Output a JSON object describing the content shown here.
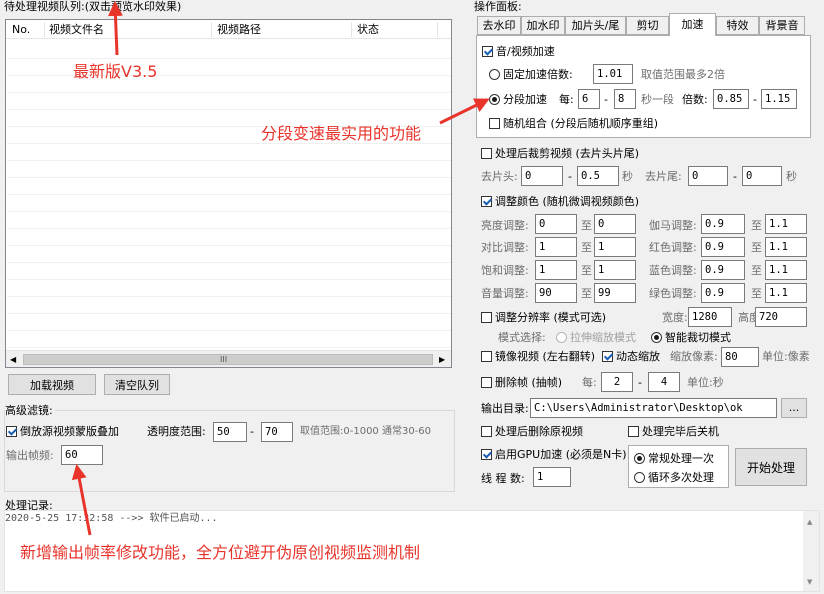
{
  "queue": {
    "title": "待处理视频队列:",
    "title_overlay": "(双击预览水印效果)",
    "columns": [
      "No.",
      "视频文件名",
      "视频路径",
      "状态"
    ],
    "scroll_mark": "III",
    "load_button": "加载视频",
    "clear_button": "清空队列"
  },
  "advanced": {
    "title": "高级滤镜:",
    "overlay_checkbox": "倒放源视频蒙版叠加",
    "transparency_label": "透明度范围:",
    "transparency_min": "50",
    "transparency_max": "70",
    "transparency_hint": "取值范围:0-1000 通常30-60",
    "fps_label": "输出帧频:",
    "fps_value": "60"
  },
  "log": {
    "title": "处理记录:",
    "entry": "2020-5-25 17:32:58 -->> 软件已启动..."
  },
  "panel": {
    "title": "操作面板:",
    "tabs": [
      "去水印",
      "加水印",
      "加片头/尾",
      "剪切",
      "加速",
      "特效",
      "背景音"
    ],
    "speed": {
      "checkbox": "音/视频加速",
      "fixed_label": "固定加速倍数:",
      "fixed_value": "1.01",
      "fixed_hint": "取值范围最多2倍",
      "segment_label": "分段加速",
      "every_label": "每:",
      "seg_min": "6",
      "seg_max": "8",
      "seg_unit": "秒一段",
      "rate_label": "倍数:",
      "rate_min": "0.85",
      "rate_max": "1.15",
      "random_checkbox": "随机组合 (分段后随机顺序重组)"
    },
    "trim": {
      "checkbox": "处理后裁剪视频 (去片头片尾)",
      "head_label": "去片头:",
      "head_min": "0",
      "head_max": "0.5",
      "sec": "秒",
      "tail_label": "去片尾:",
      "tail_min": "0",
      "tail_max": "0"
    },
    "color": {
      "checkbox": "调整颜色 (随机微调视频颜色)",
      "to": "至",
      "rows": [
        {
          "l1": "亮度调整:",
          "a1": "0",
          "b1": "0",
          "l2": "伽马调整:",
          "a2": "0.9",
          "b2": "1.1"
        },
        {
          "l1": "对比调整:",
          "a1": "1",
          "b1": "1",
          "l2": "红色调整:",
          "a2": "0.9",
          "b2": "1.1"
        },
        {
          "l1": "饱和调整:",
          "a1": "1",
          "b1": "1",
          "l2": "蓝色调整:",
          "a2": "0.9",
          "b2": "1.1"
        },
        {
          "l1": "音量调整:",
          "a1": "90",
          "b1": "99",
          "l2": "绿色调整:",
          "a2": "0.9",
          "b2": "1.1"
        }
      ]
    },
    "resolution": {
      "checkbox": "调整分辨率 (模式可选)",
      "width_label": "宽度:",
      "width": "1280",
      "height_label": "高度:",
      "height": "720",
      "mode_label": "模式选择:",
      "mode_stretch": "拉伸缩放模式",
      "mode_crop": "智能裁切模式"
    },
    "mirror_checkbox": "镜像视频 (左右翻转)",
    "zoom_checkbox": "动态缩放",
    "zoom_label": "缩放像素:",
    "zoom_value": "80",
    "zoom_unit": "单位:像素",
    "dropframe": {
      "checkbox": "删除帧 (抽帧)",
      "every_label": "每:",
      "min": "2",
      "max": "4",
      "unit": "单位:秒"
    },
    "output": {
      "label": "输出目录:",
      "path": "C:\\Users\\Administrator\\Desktop\\ok",
      "browse": "..."
    },
    "delete_source_checkbox": "处理后删除原视频",
    "shutdown_checkbox": "处理完毕后关机",
    "gpu_checkbox": "启用GPU加速 (必须是N卡)",
    "threads_label": "线 程 数:",
    "threads_value": "1",
    "mode_once": "常规处理一次",
    "mode_loop": "循环多次处理",
    "start_button": "开始处理"
  },
  "annotations": {
    "version": "最新版V3.5",
    "segment": "分段变速最实用的功能",
    "fps": "新增输出帧率修改功能，全方位避开伪原创视频监测机制"
  },
  "colors": {
    "annotation_red": "#e8342b",
    "window_bg": "#f0f0f0"
  }
}
